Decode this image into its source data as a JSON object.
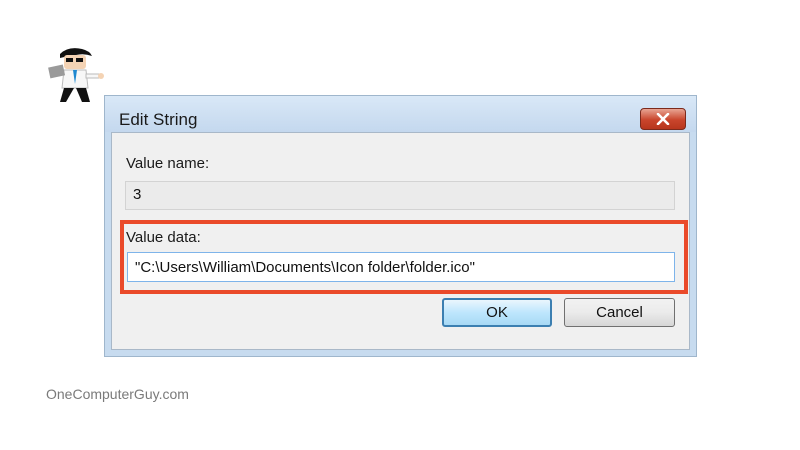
{
  "dialog": {
    "title": "Edit String",
    "close_icon": "close-icon",
    "value_name_label": "Value name:",
    "value_name": "3",
    "value_data_label": "Value data:",
    "value_data": "\"C:\\Users\\William\\Documents\\Icon folder\\folder.ico\"",
    "ok_label": "OK",
    "cancel_label": "Cancel"
  },
  "highlight_color": "#ea4a2a",
  "logo_icon": "mascot-icon",
  "watermark": "OneComputerGuy.com"
}
